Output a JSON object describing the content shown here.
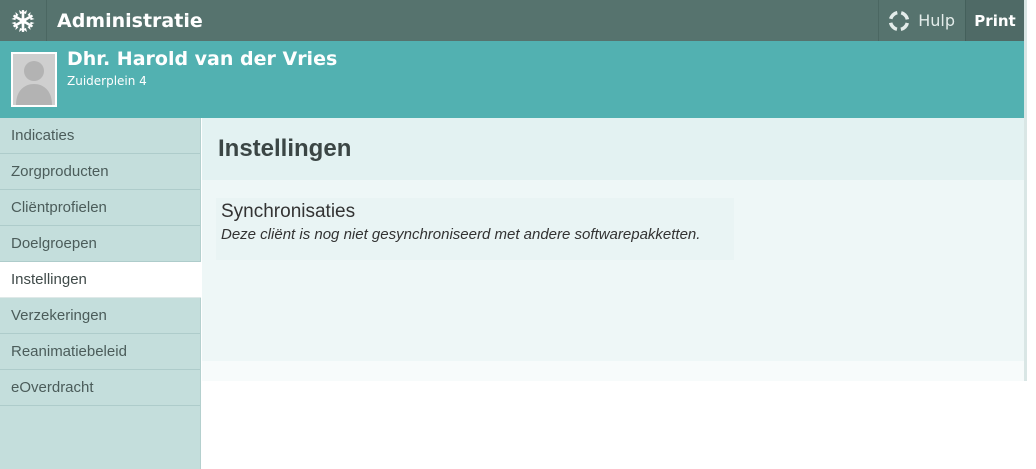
{
  "topbar": {
    "title": "Administratie",
    "help_label": "Hulp",
    "print_label": "Print",
    "logo_icon": "snowflake-logo-icon",
    "help_icon": "lifebuoy-icon",
    "bg_color": "#56736e"
  },
  "client": {
    "name": "Dhr. Harold van der Vries",
    "address": "Zuiderplein 4",
    "avatar_icon": "person-placeholder-icon",
    "band_color": "#52b1b1"
  },
  "sidebar": {
    "items": [
      {
        "label": "Indicaties"
      },
      {
        "label": "Zorgproducten"
      },
      {
        "label": "Cliëntprofielen"
      },
      {
        "label": "Doelgroepen"
      },
      {
        "label": "Instellingen",
        "active": true
      },
      {
        "label": "Verzekeringen"
      },
      {
        "label": "Reanimatiebeleid"
      },
      {
        "label": "eOverdracht"
      }
    ]
  },
  "main": {
    "title": "Instellingen",
    "section": {
      "title": "Synchronisaties",
      "text": "Deze cliënt is nog niet gesynchroniseerd met andere softwarepakketten."
    }
  }
}
